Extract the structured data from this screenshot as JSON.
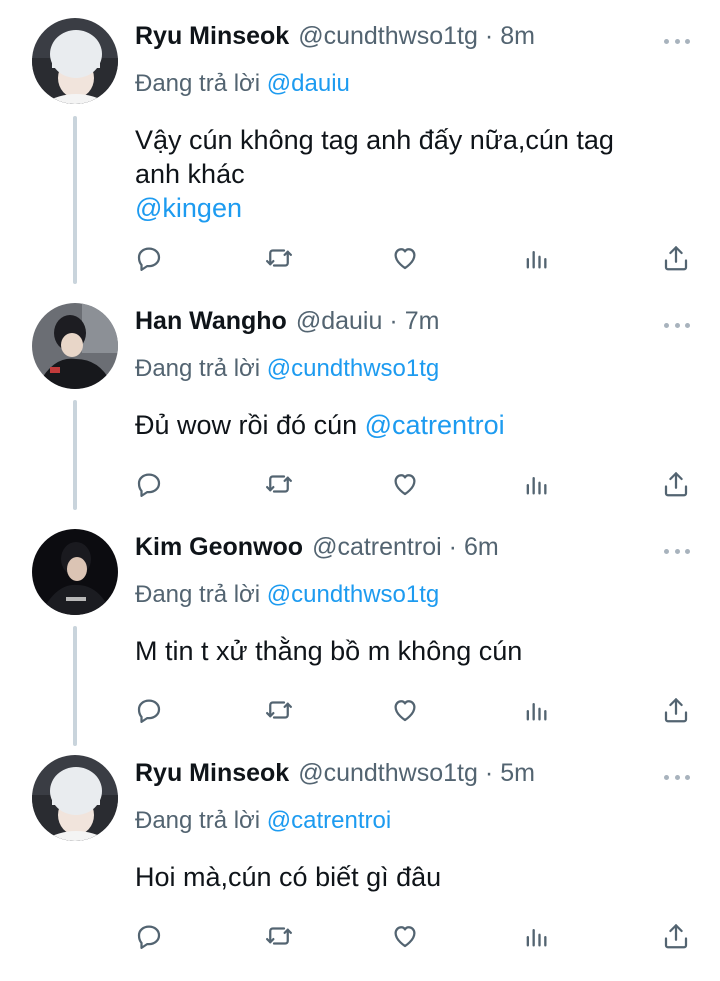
{
  "reply_prefix": "Đang trả lời",
  "tweets": [
    {
      "name": "Ryu Minseok",
      "handle": "@cundthwso1tg",
      "time": "8m",
      "reply_to": "@dauiu",
      "text_lines": [
        "Vậy cún không tag anh đấy nữa,cún tag",
        "anh khác"
      ],
      "mention_line": "@kingen",
      "avatar": "light-hair-person"
    },
    {
      "name": "Han Wangho",
      "handle": "@dauiu",
      "time": "7m",
      "reply_to": "@cundthwso1tg",
      "text": "Đủ wow rồi đó cún",
      "text_mention": "@catrentroi",
      "avatar": "dark-jersey-person"
    },
    {
      "name": "Kim Geonwoo",
      "handle": "@catrentroi",
      "time": "6m",
      "reply_to": "@cundthwso1tg",
      "text": "M tin t xử thằng bồ m không cún",
      "avatar": "dark-jersey-person"
    },
    {
      "name": "Ryu Minseok",
      "handle": "@cundthwso1tg",
      "time": "5m",
      "reply_to": "@catrentroi",
      "text": "Hoi mà,cún có biết gì đâu",
      "avatar": "light-hair-person"
    }
  ],
  "icons": {
    "reply": "reply-icon",
    "retweet": "retweet-icon",
    "like": "heart-icon",
    "views": "views-icon",
    "share": "share-icon",
    "more": "more-icon"
  },
  "colors": {
    "text": "#0f1419",
    "secondary": "#536471",
    "mention": "#1d9bf0",
    "thread_line": "#c9d4dc",
    "icon": "#536471"
  }
}
